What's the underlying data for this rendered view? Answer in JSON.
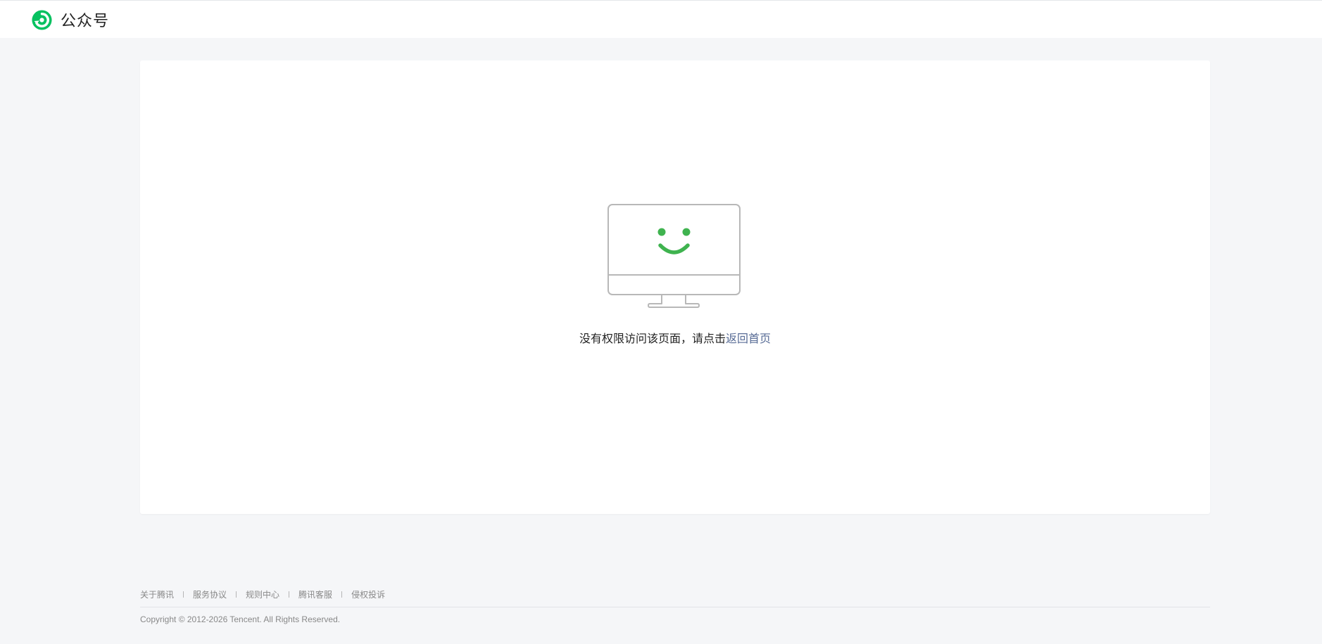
{
  "header": {
    "brand_name": "公众号",
    "logo_icon": "wechat-official-account-logo",
    "accent_color": "#07c160"
  },
  "main": {
    "illustration_icon": "smiling-monitor-icon",
    "message_text": "没有权限访问该页面，请点击",
    "message_link": "返回首页",
    "link_color": "#576b95",
    "smile_color": "#3fb34f"
  },
  "footer": {
    "links": [
      "关于腾讯",
      "服务协议",
      "规则中心",
      "腾讯客服",
      "侵权投诉"
    ],
    "copyright": "Copyright © 2012-2026 Tencent. All Rights Reserved."
  }
}
